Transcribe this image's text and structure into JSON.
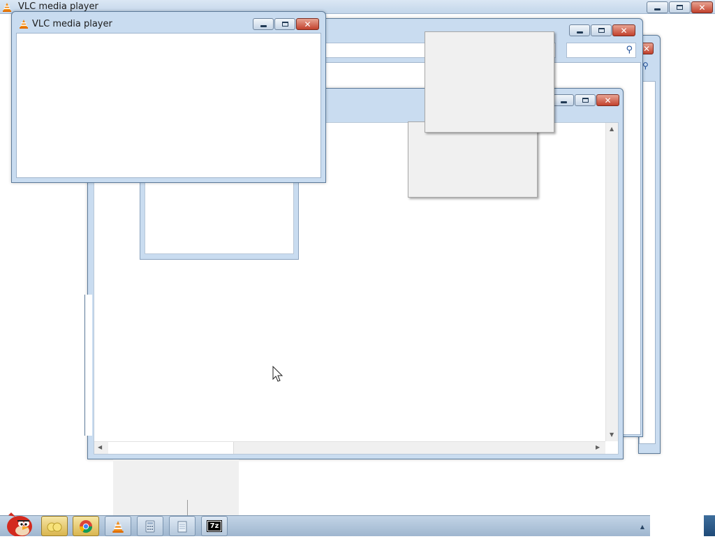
{
  "desktop": {
    "top_window": {
      "title": "VLC media player",
      "controls": {
        "minimize": "minimize",
        "restore": "restore",
        "close": "close"
      }
    },
    "vlc_window": {
      "title": "VLC media player"
    }
  },
  "taskbar": {
    "buttons": [
      {
        "name": "angry-birds",
        "icon": "angry-bird-icon"
      },
      {
        "name": "windows-explorer",
        "icon": "folder-icon"
      },
      {
        "name": "google-chrome",
        "icon": "chrome-icon"
      },
      {
        "name": "vlc-media-player",
        "icon": "vlc-icon"
      },
      {
        "name": "calculator",
        "icon": "calculator-icon"
      },
      {
        "name": "notepad",
        "icon": "notepad-icon"
      },
      {
        "name": "7-zip",
        "icon": "7zip-icon",
        "label": "7z"
      }
    ],
    "tray_arrow": "▲"
  },
  "colors": {
    "window_frame": "#c9dcf0",
    "close_button": "#c2412d",
    "taskbar": "#b3c7dc"
  }
}
